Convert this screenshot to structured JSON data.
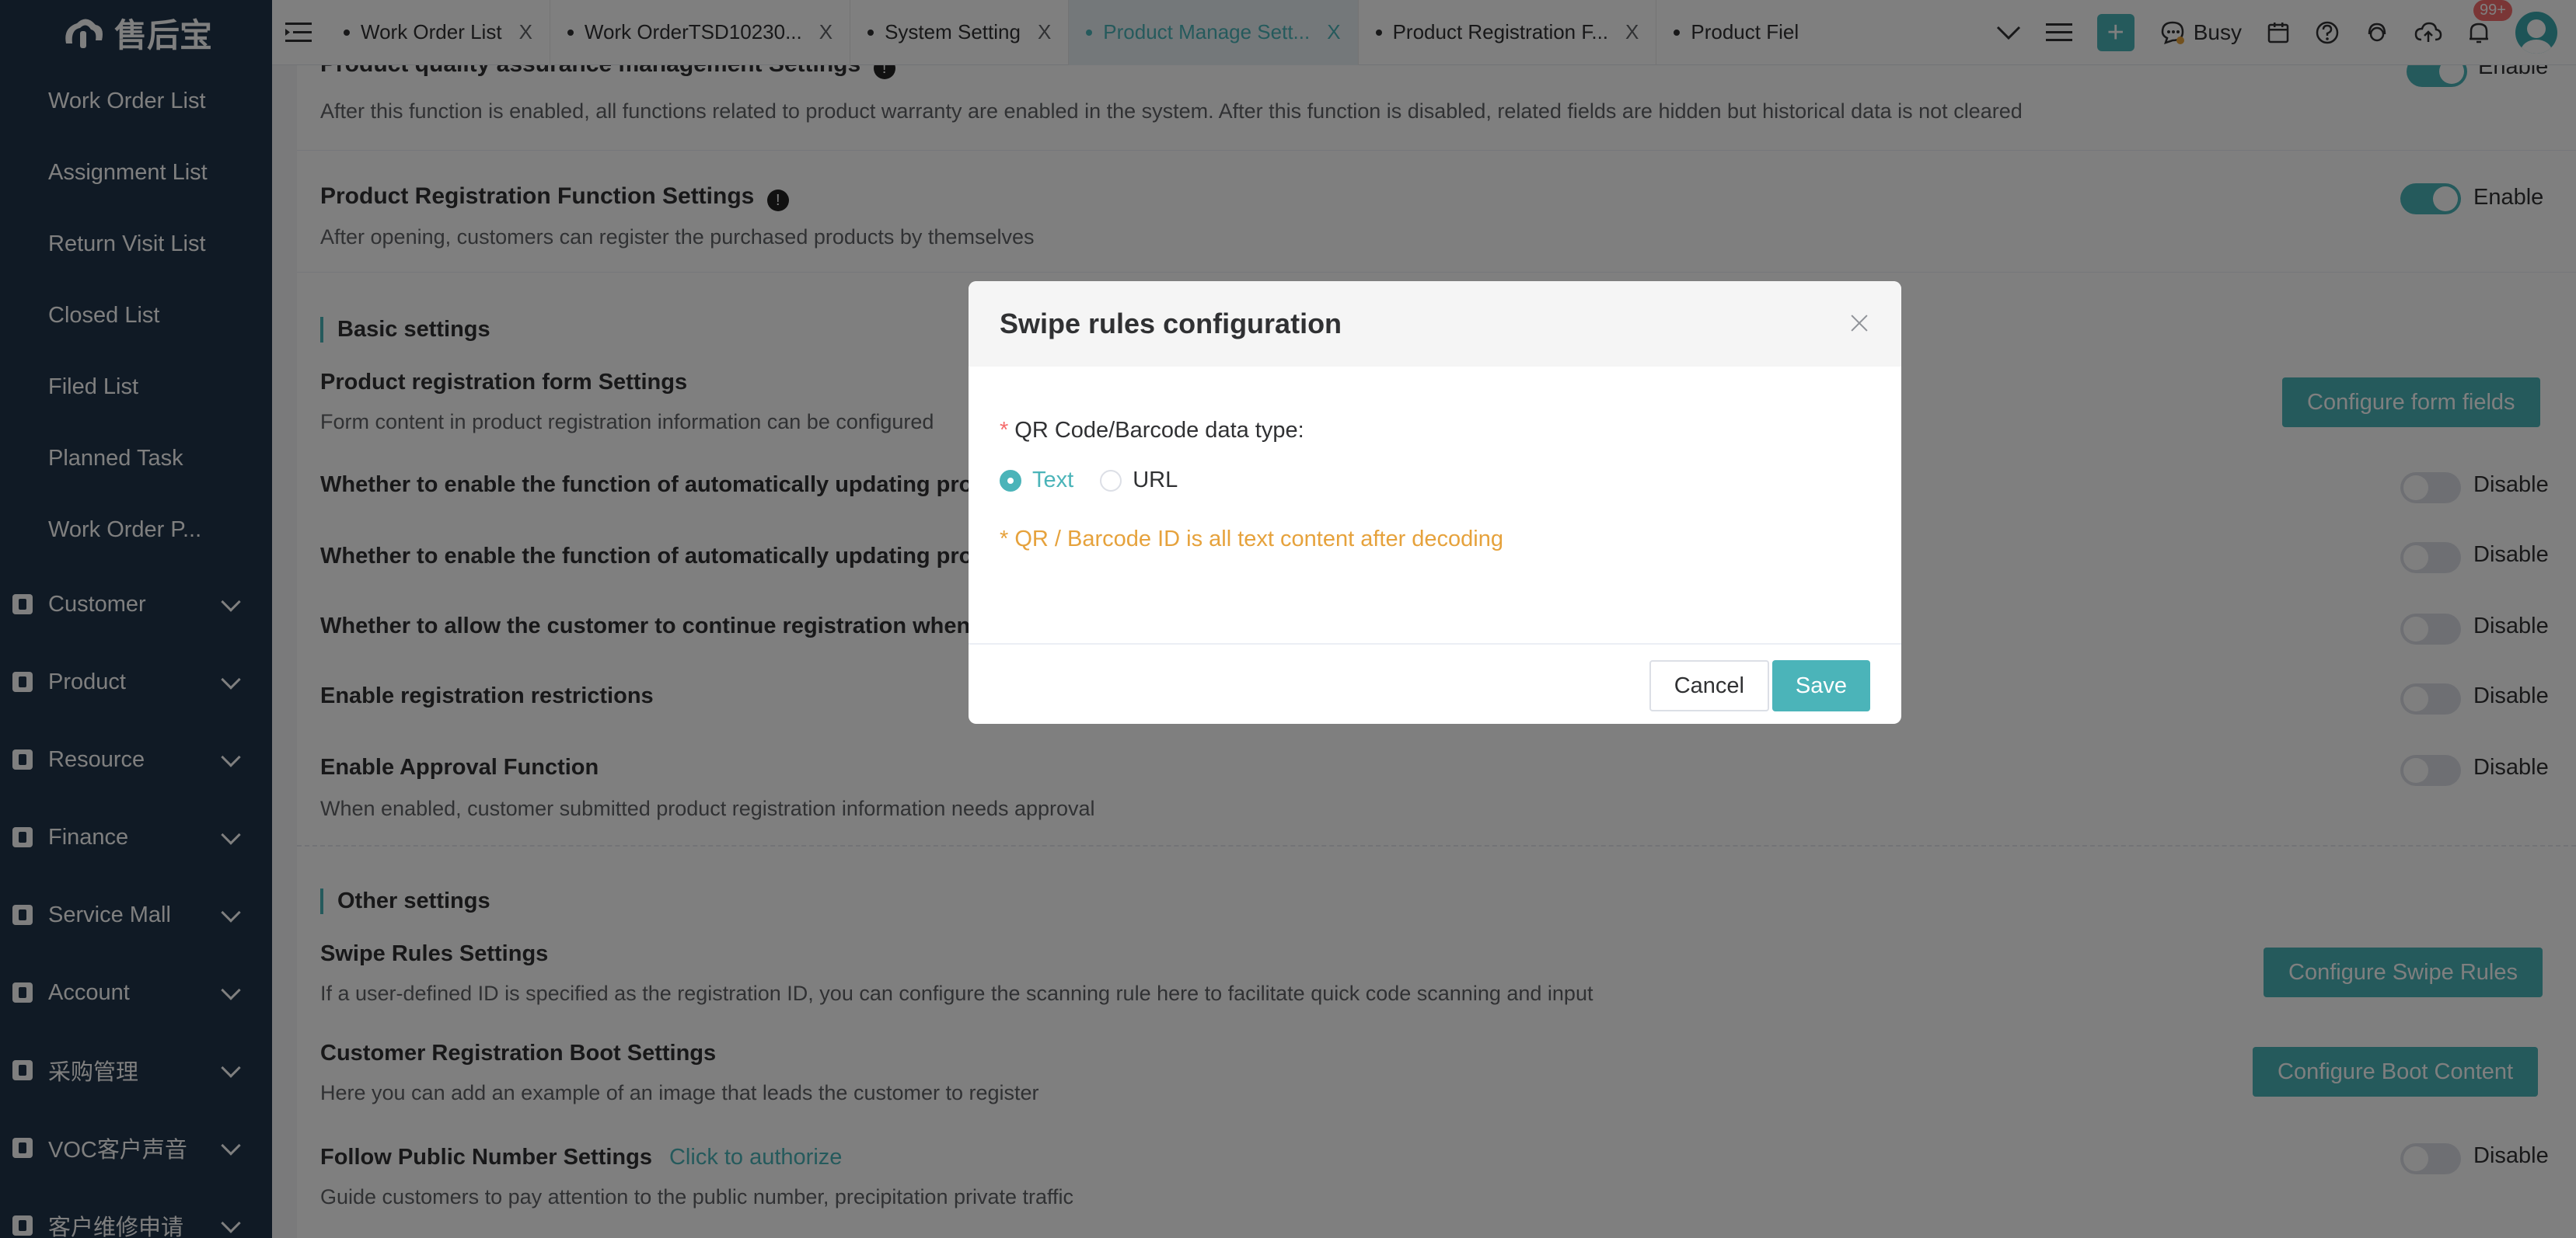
{
  "app": {
    "logo_text": "售后宝"
  },
  "sidebar": {
    "items": [
      {
        "label": "Work Order List"
      },
      {
        "label": "Assignment List"
      },
      {
        "label": "Return Visit List"
      },
      {
        "label": "Closed List"
      },
      {
        "label": "Filed List"
      },
      {
        "label": "Planned Task"
      },
      {
        "label": "Work Order P..."
      }
    ],
    "groups": [
      {
        "label": "Customer"
      },
      {
        "label": "Product"
      },
      {
        "label": "Resource"
      },
      {
        "label": "Finance"
      },
      {
        "label": "Service Mall"
      },
      {
        "label": "Account"
      },
      {
        "label": "采购管理"
      },
      {
        "label": "VOC客户声音"
      },
      {
        "label": "客户维修申请"
      }
    ]
  },
  "tabs": [
    {
      "label": "Work Order List",
      "close": "X"
    },
    {
      "label": "Work OrderTSD10230...",
      "close": "X"
    },
    {
      "label": "System Setting",
      "close": "X"
    },
    {
      "label": "Product Manage Sett...",
      "close": "X"
    },
    {
      "label": "Product Registration F...",
      "close": "X"
    },
    {
      "label": "Product Fiel",
      "close": ""
    }
  ],
  "topbar": {
    "status_label": "Busy",
    "notification_count": "99+",
    "plus_label": "+"
  },
  "page": {
    "qa_title": "Product quality assurance management Settings",
    "qa_desc": "After this function is enabled, all functions related to product warranty are enabled in the system. After this function is disabled, related fields are hidden but historical data is not cleared",
    "qa_switch": "Enable",
    "reg_title": "Product Registration Function Settings",
    "reg_desc": "After opening, customers can register the purchased products by themselves",
    "reg_switch": "Enable",
    "basic_label": "Basic settings",
    "form_title": "Product registration form Settings",
    "form_desc": "Form content in product registration information can be configured",
    "form_button": "Configure form fields",
    "auto1_title": "Whether to enable the function of automatically updating produ",
    "auto1_switch": "Disable",
    "auto2_title": "Whether to enable the function of automatically updating produ",
    "auto2_switch": "Disable",
    "allow_title": "Whether to allow the customer to continue registration when th",
    "allow_switch": "Disable",
    "restrict_title": "Enable registration restrictions",
    "restrict_switch": "Disable",
    "approval_title": "Enable Approval Function",
    "approval_desc": "When enabled, customer submitted product registration information needs approval",
    "approval_switch": "Disable",
    "other_label": "Other settings",
    "swipe_title": "Swipe Rules Settings",
    "swipe_desc": "If a user-defined ID is specified as the registration ID, you can configure the scanning rule here to facilitate quick code scanning and input",
    "swipe_button": "Configure Swipe Rules",
    "boot_title": "Customer Registration Boot Settings",
    "boot_desc": "Here you can add an example of an image that leads the customer to register",
    "boot_button": "Configure Boot Content",
    "follow_title": "Follow Public Number Settings",
    "follow_link": "Click to authorize",
    "follow_desc": "Guide customers to pay attention to the public number, precipitation private traffic",
    "follow_switch": "Disable"
  },
  "dialog": {
    "title": "Swipe rules configuration",
    "field_label": "QR Code/Barcode data type:",
    "required_mark": "*",
    "options": [
      {
        "label": "Text",
        "checked": true
      },
      {
        "label": "URL",
        "checked": false
      }
    ],
    "hint": "* QR / Barcode ID is all text content after decoding",
    "cancel": "Cancel",
    "save": "Save"
  },
  "colors": {
    "accent": "#4bb4b9",
    "sidebar": "#21354a",
    "hint": "#e6a23c"
  }
}
